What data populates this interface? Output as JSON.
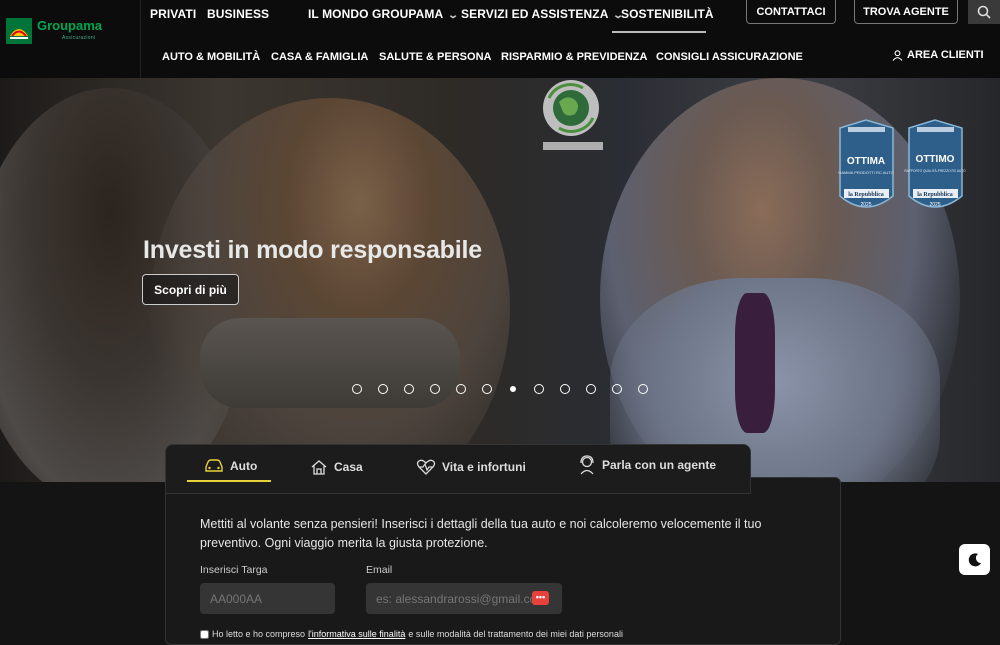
{
  "header": {
    "logo": {
      "name": "Groupama",
      "tagline": "Assicurazioni"
    },
    "top_nav": [
      {
        "label": "PRIVATI",
        "has_chevron": false
      },
      {
        "label": "BUSINESS",
        "has_chevron": false
      },
      {
        "label": "IL MONDO GROUPAMA",
        "has_chevron": true
      },
      {
        "label": "SERVIZI ED ASSISTENZA",
        "has_chevron": true
      },
      {
        "label": "SOSTENIBILITÀ",
        "has_chevron": false
      }
    ],
    "contact_label": "CONTATTACI",
    "find_agent_label": "TROVA AGENTE",
    "search_icon": "search-icon",
    "bottom_nav": [
      "AUTO & MOBILITÀ",
      "CASA & FAMIGLIA",
      "SALUTE & PERSONA",
      "RISPARMIO & PREVIDENZA",
      "CONSIGLI ASSICURAZIONE"
    ],
    "client_area_label": "AREA CLIENTI"
  },
  "hero": {
    "title": "Investi in modo responsabile",
    "cta_label": "Scopri di più",
    "slide_count": 12,
    "active_slide": 7,
    "badges": [
      {
        "rating": "OTTIMA",
        "caption": "GAMMA PRODOTTI RC AUTO",
        "publisher": "la Repubblica",
        "year": "2025"
      },
      {
        "rating": "OTTIMO",
        "caption": "RAPPORTO QUALITÀ-PREZZO RC AUTO",
        "publisher": "la Repubblica",
        "year": "2025"
      }
    ]
  },
  "quote": {
    "tabs": [
      {
        "label": "Auto",
        "icon": "car-icon"
      },
      {
        "label": "Casa",
        "icon": "house-icon"
      },
      {
        "label": "Vita e infortuni",
        "icon": "heartbeat-icon"
      },
      {
        "label": "Parla con un agente",
        "icon": "agent-icon"
      }
    ],
    "intro": "Mettiti al volante senza pensieri! Inserisci i dettagli della tua auto e noi calcoleremo velocemente il tuo preventivo. Ogni viaggio merita la giusta protezione.",
    "plate_label": "Inserisci Targa",
    "plate_placeholder": "AA000AA",
    "email_label": "Email",
    "email_placeholder": "es: alessandrarossi@gmail.com",
    "consent_prefix": "Ho letto e ho compreso",
    "consent_link": "l'informativa sulle finalità",
    "consent_suffix": "e sulle modalità del trattamento dei miei dati personali"
  },
  "colors": {
    "brand_green": "#00a651",
    "tab_accent": "#e7d23a",
    "background": "#141414"
  }
}
